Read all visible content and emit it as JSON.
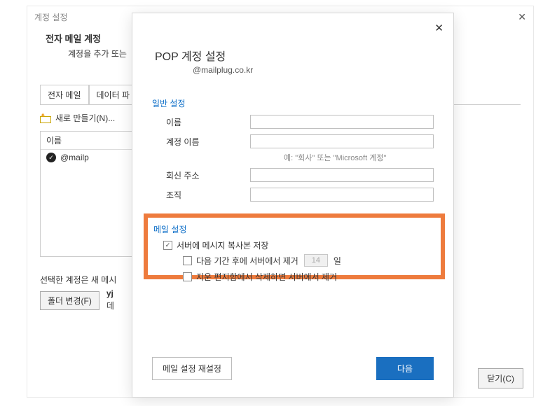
{
  "backWindow": {
    "title": "계정 설정",
    "heading": "전자 메일 계정",
    "subheading": "계정을 추가 또는",
    "tabs": {
      "email": "전자 메일",
      "dataFiles": "데이터 파"
    },
    "toolbar": {
      "new": "새로 만들기(N)..."
    },
    "list": {
      "headerName": "이름",
      "row0": "@mailp"
    },
    "selectedLabel": "선택한 계정은 새 메시",
    "folderChange": "폴더 변경(F)",
    "yj": "yj",
    "yj2": "데",
    "close": "닫기(C)"
  },
  "frontModal": {
    "title": "POP 계정 설정",
    "subtitle": "@mailplug.co.kr",
    "sectionGeneral": "일반 설정",
    "labels": {
      "name": "이름",
      "accountName": "계정 이름",
      "replyAddress": "회신 주소",
      "org": "조직"
    },
    "hint": "예: \"회사\" 또는 \"Microsoft 계정\"",
    "sectionMail": "메일 설정",
    "chk1": "서버에 메시지 복사본 저장",
    "chk2_pre": "다음 기간 후에 서버에서 제거",
    "chk2_days": "14",
    "chk2_post": "일",
    "chk3": "지운 편지함에서 삭제하면 서버에서 제거",
    "btnReset": "메일 설정 재설정",
    "btnNext": "다음"
  }
}
